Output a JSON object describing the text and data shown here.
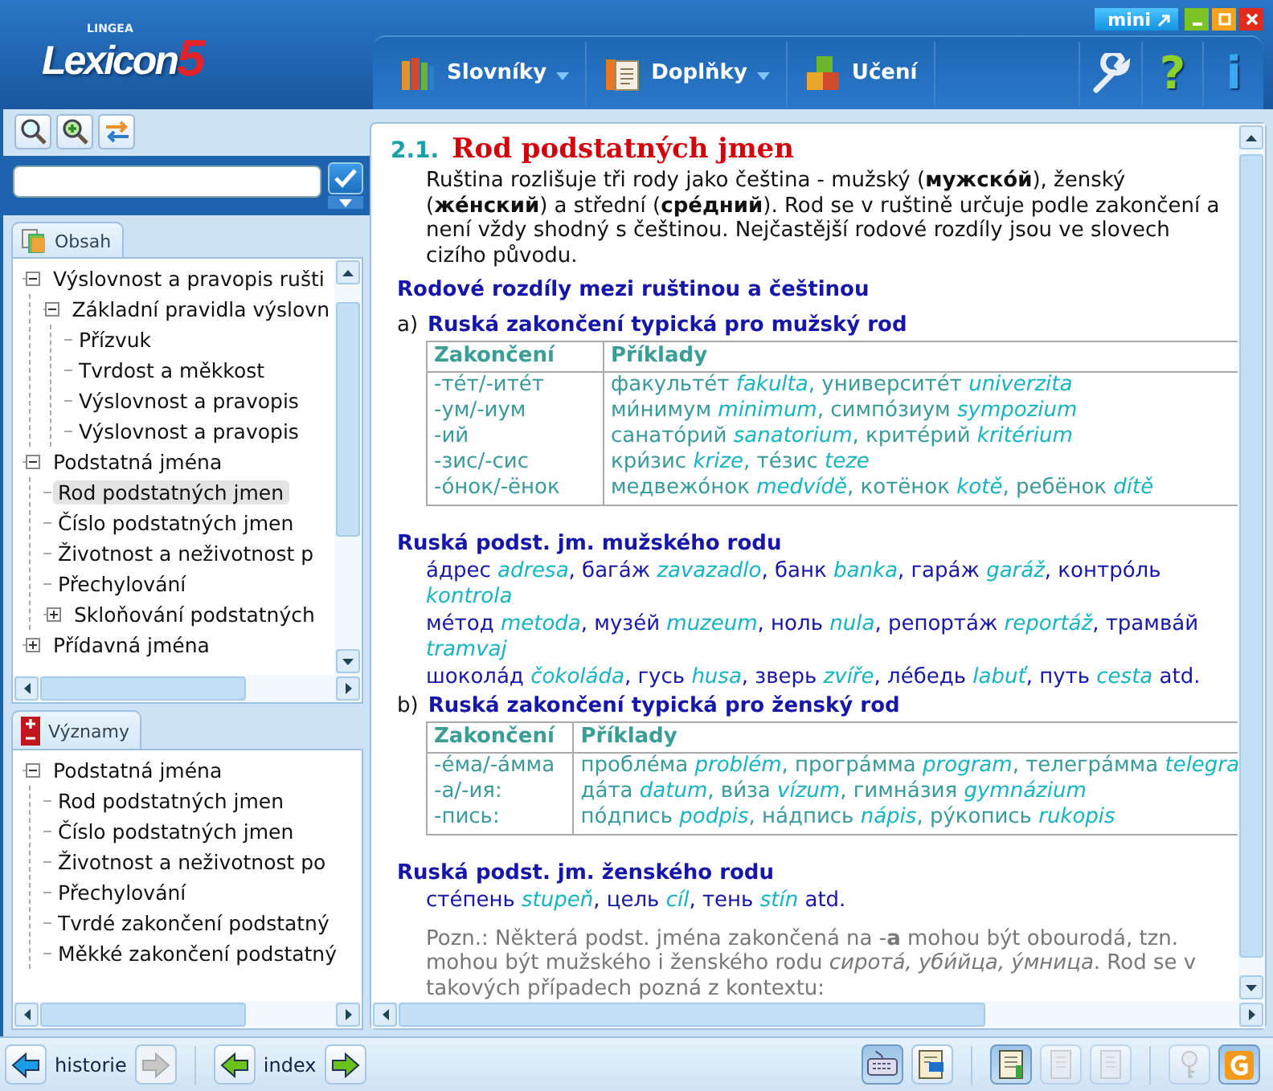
{
  "window": {
    "mini_label": "mini"
  },
  "logo": {
    "brand": "LINGEA",
    "name": "Lexicon",
    "version": "5"
  },
  "menu": [
    {
      "label": "Slovníky",
      "dropdown": true,
      "kind": "books"
    },
    {
      "label": "Doplňky",
      "dropdown": true,
      "kind": "pages"
    },
    {
      "label": "Učení",
      "dropdown": false,
      "kind": "blocks"
    }
  ],
  "toolbar": {
    "help": "?",
    "info": "i"
  },
  "contents": {
    "tab": "Obsah",
    "tree": [
      {
        "label": "Výslovnost a pravopis rušti",
        "expanded": true,
        "selected": false,
        "children": [
          {
            "label": "Základní pravidla výslovn",
            "expanded": true,
            "selected": false,
            "children": [
              {
                "label": "Přízvuk",
                "selected": false
              },
              {
                "label": "Tvrdost a měkkost",
                "selected": false
              },
              {
                "label": "Výslovnost a pravopis",
                "selected": false
              },
              {
                "label": "Výslovnost a pravopis",
                "selected": false
              }
            ]
          }
        ]
      },
      {
        "label": "Podstatná jména",
        "expanded": true,
        "selected": false,
        "children": [
          {
            "label": "Rod podstatných jmen",
            "selected": true
          },
          {
            "label": "Číslo podstatných jmen",
            "selected": false
          },
          {
            "label": "Životnost a neživotnost p",
            "selected": false
          },
          {
            "label": "Přechylování",
            "selected": false
          },
          {
            "label": "Skloňování podstatných",
            "expanded": false,
            "selected": false
          }
        ]
      },
      {
        "label": "Přídavná jména",
        "expanded": false,
        "selected": false
      }
    ]
  },
  "meanings": {
    "tab": "Významy",
    "tree": [
      {
        "label": "Podstatná jména",
        "expanded": true,
        "selected": false,
        "children": [
          {
            "label": "Rod podstatných jmen",
            "selected": false
          },
          {
            "label": "Číslo podstatných jmen",
            "selected": false
          },
          {
            "label": "Životnost a neživotnost po",
            "selected": false
          },
          {
            "label": "Přechylování",
            "selected": false
          },
          {
            "label": "Tvrdé zakončení podstatný",
            "selected": false
          },
          {
            "label": "Měkké zakončení podstatný",
            "selected": false
          }
        ]
      }
    ]
  },
  "article": {
    "number": "2.1.",
    "title": "Rod podstatných jmen",
    "intro": "Ruština rozlišuje tři rody jako čeština - mužský (**мужско́й**), ženský (**же́нский**) a střední (**сре́дний**). Rod se v ruštině určuje podle zakončení a není vždy shodný s češtinou. Nejčastější rodové rozdíly jsou ve slovech cizího původu.",
    "heading": "Rodové rozdíly mezi ruštinou a češtinou",
    "blocks": [
      {
        "kind": "table",
        "letter": "a)",
        "heading": "Ruská zakončení typická pro mužský rod",
        "columns": [
          "Zakončení",
          "Příklady"
        ],
        "rows": [
          [
            "-те́т/-ите́т",
            "факульте́т *fakulta*, университе́т *univerzita*"
          ],
          [
            "-ум/-иум",
            "ми́нимум *minimum*, симпо́зиум *sympozium*"
          ],
          [
            "-ий",
            "санато́рий *sanatorium*, крите́рий *kritérium*"
          ],
          [
            "-зис/-сис",
            "кри́зис *krize*, те́зис *teze*"
          ],
          [
            "-о́нок/-ёнок",
            "медвежо́нок *medvídě*, котёнок *kotě*, ребёнок *dítě*"
          ]
        ]
      },
      {
        "kind": "examples",
        "heading": "Ruská podst. jm. mužského rodu",
        "lines": [
          "а́дрес *adresa*, бага́ж *zavazadlo*, банк *banka*, гара́ж *garáž*, контро́ль *kontrola*",
          "ме́тод *metoda*, музе́й *muzeum*, ноль *nula*, репорта́ж *reportáž*, трамва́й *tramvaj*",
          "шокола́д *čokoláda*, гусь *husa*, зверь *zvíře*, ле́бедь *labuť*, путь *cesta* atd."
        ]
      },
      {
        "kind": "table",
        "letter": "b)",
        "heading": "Ruská zakončení typická pro ženský rod",
        "columns": [
          "Zakončení",
          "Příklady"
        ],
        "rows": [
          [
            "-е́ма/-а́мма",
            "пробле́ма *problém*, програ́мма *program*, телегра́мма *telegra*"
          ],
          [
            "-а/-ия:",
            "да́та *datum*, ви́за *vízum*, гимна́зия *gymnázium*"
          ],
          [
            "-пись:",
            "по́дпись *podpis*, на́дпись *nápis*, ру́копись *rukopis*"
          ]
        ]
      },
      {
        "kind": "examples",
        "heading": "Ruská podst. jm. ženského rodu",
        "lines": [
          "сте́пень *stupeň*, цель *cíl*, тень *stín* atd."
        ]
      },
      {
        "kind": "note",
        "text": "Pozn.: Některá podst. jména zakončená na -**a** mohou být obourodá, tzn. mohou být mužského i ženského rodu *сирота́, уби́йца, у́мница*. Rod se v takových případech pozná z kontextu:"
      }
    ]
  },
  "history": {
    "label": "historie",
    "back": {
      "disabled": false
    },
    "forward": {
      "disabled": true
    }
  },
  "index": {
    "label": "index",
    "back": {
      "disabled": false
    },
    "forward": {
      "disabled": false
    }
  },
  "tools": [
    {
      "kind": "keyboard",
      "pressed": true,
      "disabled": false
    },
    {
      "kind": "book",
      "pressed": false,
      "disabled": false
    },
    {
      "kind": "notebook",
      "pressed": true,
      "disabled": false
    },
    {
      "kind": "page",
      "pressed": false,
      "disabled": true
    },
    {
      "kind": "page",
      "pressed": false,
      "disabled": true
    },
    {
      "kind": "key",
      "pressed": false,
      "disabled": true
    },
    {
      "kind": "g",
      "pressed": true,
      "disabled": false
    }
  ]
}
